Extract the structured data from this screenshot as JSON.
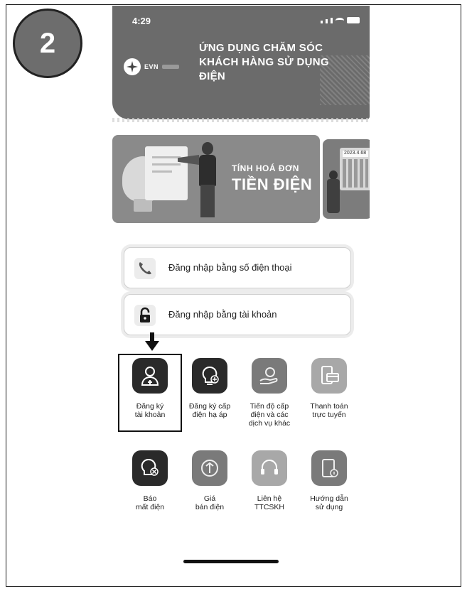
{
  "step_badge": "2",
  "status_bar": {
    "time": "4:29"
  },
  "header": {
    "logo_text": "EVN",
    "title_line1": "ỨNG DỤNG CHĂM SÓC",
    "title_line2": "KHÁCH HÀNG SỬ DỤNG",
    "title_line3": "ĐIỆN"
  },
  "banner": {
    "small_text": "TÍNH HOÁ ĐƠN",
    "big_text": "TIỀN ĐIỆN",
    "calc_text": "2023.4.68"
  },
  "login": {
    "phone_label": "Đăng nhập bằng số điện thoại",
    "account_label": "Đăng nhập bằng tài khoản"
  },
  "services": [
    {
      "line1": "Đăng ký",
      "line2": "tài khoản",
      "line3": ""
    },
    {
      "line1": "Đăng ký cấp",
      "line2": "điện hạ áp",
      "line3": ""
    },
    {
      "line1": "Tiến độ cấp",
      "line2": "điện và các",
      "line3": "dịch vụ khác"
    },
    {
      "line1": "Thanh toán",
      "line2": "trực tuyến",
      "line3": ""
    },
    {
      "line1": "Báo",
      "line2": "mất điện",
      "line3": ""
    },
    {
      "line1": "Giá",
      "line2": "bán điện",
      "line3": ""
    },
    {
      "line1": "Liên hệ",
      "line2": "TTCSKH",
      "line3": ""
    },
    {
      "line1": "Hướng dẫn",
      "line2": "sử dụng",
      "line3": ""
    }
  ]
}
